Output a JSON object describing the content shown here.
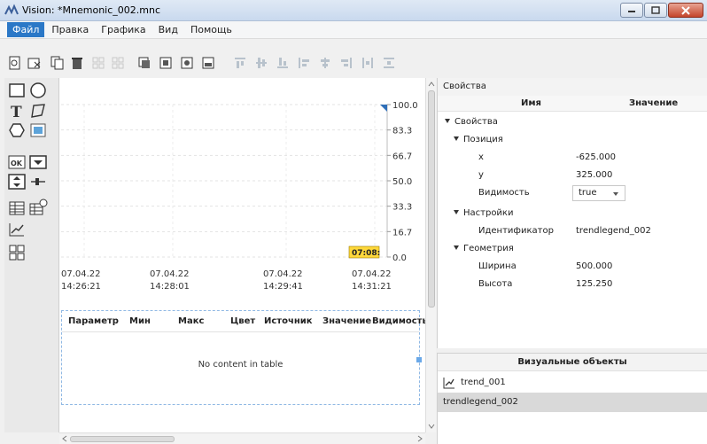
{
  "window": {
    "title": "Vision: *Mnemonic_002.mnc"
  },
  "menu": [
    "Файл",
    "Правка",
    "Графика",
    "Вид",
    "Помощь"
  ],
  "toolbar_icons": [
    "new-icon",
    "close-doc-icon",
    "copy-icon",
    "delete-icon",
    "grid-icon",
    "grid-alt-icon",
    "layer-icon",
    "layer-front-icon",
    "layer-back-icon",
    "layer-bottom-icon",
    "align-top-icon",
    "align-middle-icon",
    "align-bottom-icon",
    "align-left-icon",
    "align-center-icon",
    "align-right-icon",
    "distribute-h-icon",
    "distribute-v-icon"
  ],
  "palette_icons": [
    "rectangle-icon",
    "ellipse-icon",
    "text-icon",
    "polyline-icon",
    "polygon-icon",
    "image-icon",
    "ok-button-icon",
    "combobox-icon",
    "spinbox-icon",
    "slider-icon",
    "table-icon",
    "table-time-icon",
    "trend-icon",
    "legend-icon"
  ],
  "chart_data": {
    "type": "line",
    "ylim": [
      0,
      100
    ],
    "y_ticks": [
      "100.0",
      "83.3",
      "66.7",
      "50.0",
      "33.3",
      "16.7",
      "0.0"
    ],
    "x_ticks": [
      {
        "date": "07.04.22",
        "time": "14:26:21"
      },
      {
        "date": "07.04.22",
        "time": "14:28:01"
      },
      {
        "date": "07.04.22",
        "time": "14:29:41"
      },
      {
        "date": "07.04.22",
        "time": "14:31:21"
      }
    ],
    "cursor_label": "07:08:",
    "series": []
  },
  "legend_table": {
    "columns": [
      "Параметр",
      "Мин",
      "Макс",
      "Цвет",
      "Источник",
      "Значение",
      "Видимость"
    ],
    "empty_text": "No content in table"
  },
  "properties": {
    "panel_title": "Свойства",
    "col_name": "Имя",
    "col_value": "Значение",
    "root": "Свойства",
    "position": "Позиция",
    "x_label": "x",
    "x_value": "-625.000",
    "y_label": "y",
    "y_value": "325.000",
    "visibility_label": "Видимость",
    "visibility_value": "true",
    "settings": "Настройки",
    "id_label": "Идентификатор",
    "id_value": "trendlegend_002",
    "geometry": "Геометрия",
    "width_label": "Ширина",
    "width_value": "500.000",
    "height_label": "Высота",
    "height_value": "125.250"
  },
  "visual_objects": {
    "title": "Визуальные объекты",
    "items": [
      "trend_001",
      "trendlegend_002"
    ],
    "selected": "trendlegend_002"
  }
}
